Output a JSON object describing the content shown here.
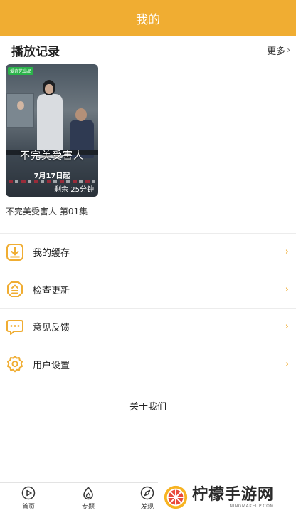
{
  "header": {
    "title": "我的"
  },
  "history": {
    "title": "播放记录",
    "more_label": "更多",
    "items": [
      {
        "poster_badge": "爱奇艺出品",
        "poster_title": "不完美受害人",
        "poster_date": "7月17日起",
        "remaining": "剩余 25分钟",
        "episode_label": "不完美受害人 第01集"
      }
    ]
  },
  "menu": {
    "items": [
      {
        "label": "我的缓存",
        "icon": "download-icon"
      },
      {
        "label": "检查更新",
        "icon": "update-icon"
      },
      {
        "label": "意见反馈",
        "icon": "feedback-icon"
      },
      {
        "label": "用户设置",
        "icon": "settings-icon"
      }
    ]
  },
  "about_label": "关于我们",
  "tabbar": {
    "items": [
      {
        "label": "首页",
        "icon": "play-circle-icon"
      },
      {
        "label": "专题",
        "icon": "topic-icon"
      },
      {
        "label": "发现",
        "icon": "compass-icon"
      }
    ]
  },
  "watermark": {
    "title": "柠檬手游网",
    "subtitle": "NINGMAKEUP.COM"
  },
  "colors": {
    "accent": "#f0ad32",
    "divider": "#ececec"
  }
}
